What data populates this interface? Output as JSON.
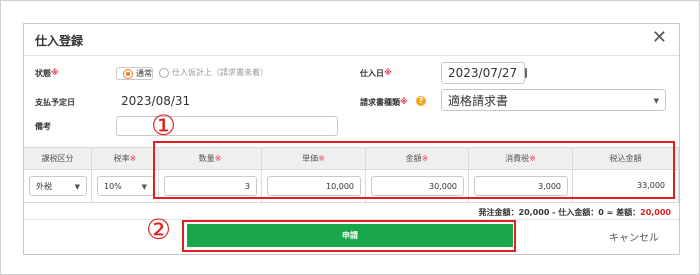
{
  "dialog": {
    "title": "仕入登録",
    "close_glyph": "✕"
  },
  "form": {
    "status_label": "状態",
    "status_options": [
      "通常",
      "仕入仮計上（請求書未着）"
    ],
    "status_selected": "通常",
    "purchase_date_label": "仕入日",
    "purchase_date_value": "2023/07/27",
    "payment_date_label": "支払予定日",
    "payment_date_value": "2023/08/31",
    "invoice_type_label": "請求書種類",
    "invoice_type_value": "適格請求書",
    "note_label": "備考",
    "note_value": "",
    "required_mark": "※",
    "help_glyph": "?"
  },
  "table": {
    "headers": {
      "tax_category": "課税区分",
      "tax_rate": "税率",
      "quantity": "数量",
      "unit_price": "単価",
      "amount": "金額",
      "consumption_tax": "消費税",
      "total_with_tax": "税込金額"
    },
    "row": {
      "tax_category": "外税",
      "tax_rate": "10%",
      "quantity": "3",
      "unit_price": "10,000",
      "amount": "30,000",
      "consumption_tax": "3,000",
      "total_with_tax": "33,000"
    }
  },
  "summary": {
    "text": "発注金額：20,000 - 仕入金額：0 = 差額：",
    "difference": "20,000"
  },
  "actions": {
    "apply_label": "申請",
    "cancel_label": "キャンセル"
  },
  "annotations": {
    "marker_1": "①",
    "marker_2": "②"
  },
  "colors": {
    "accent_orange": "#f07a1e",
    "apply_green": "#1aa64a",
    "annotation_red": "#e02020",
    "required_red": "#e8384f"
  }
}
